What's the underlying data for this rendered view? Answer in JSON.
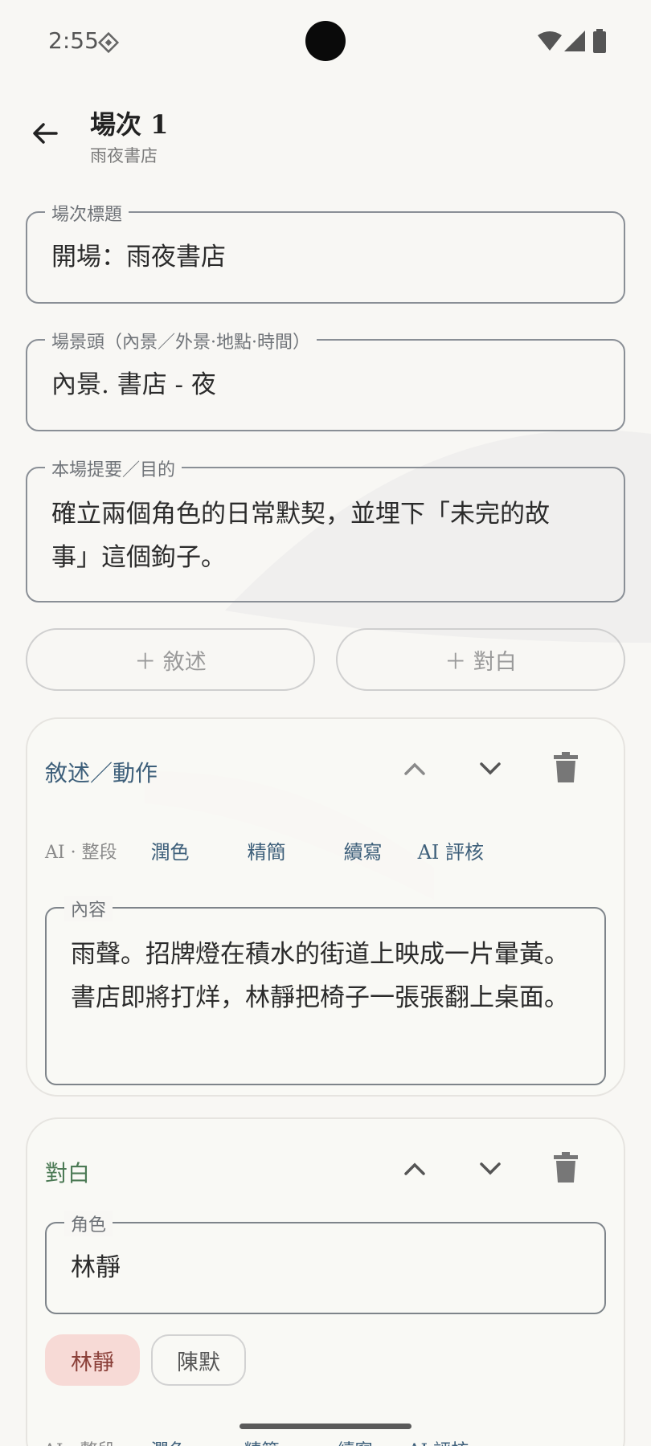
{
  "status": {
    "time": "2:55"
  },
  "header": {
    "title": "場次 1",
    "subtitle": "雨夜書店"
  },
  "fields": {
    "scene_title": {
      "label": "場次標題",
      "value": "開場：雨夜書店"
    },
    "slugline": {
      "label": "場景頭（內景／外景·地點·時間）",
      "value": "內景. 書店 - 夜"
    },
    "summary": {
      "label": "本場提要／目的",
      "line1": "確立兩個角色的日常默契，並埋下「未完的故",
      "line2": "事」這個鉤子。"
    }
  },
  "actions": {
    "add_narration": "＋ 敘述",
    "add_dialogue": "＋ 對白"
  },
  "blocks": [
    {
      "type_label": "敘述／動作",
      "ai": {
        "tag": "AI · 整段",
        "polish": "潤色",
        "trim": "精簡",
        "continue": "續寫",
        "review": "AI 評核"
      },
      "content_label": "內容",
      "line1": "雨聲。招牌燈在積水的街道上映成一片暈黃。",
      "line2": "書店即將打烊，林靜把椅子一張張翻上桌面。"
    },
    {
      "type_label": "對白",
      "character_label": "角色",
      "character_value": "林靜",
      "chips": [
        "林靜",
        "陳默"
      ],
      "ai_partial": {
        "tag": "AI · 整段",
        "polish": "潤色",
        "trim": "精簡",
        "continue": "續寫",
        "review": "AI 評核"
      }
    }
  ],
  "colors": {
    "accent": "#3d5f7a",
    "dialog": "#4c7a55",
    "chip_selected": "#f7dad6"
  }
}
